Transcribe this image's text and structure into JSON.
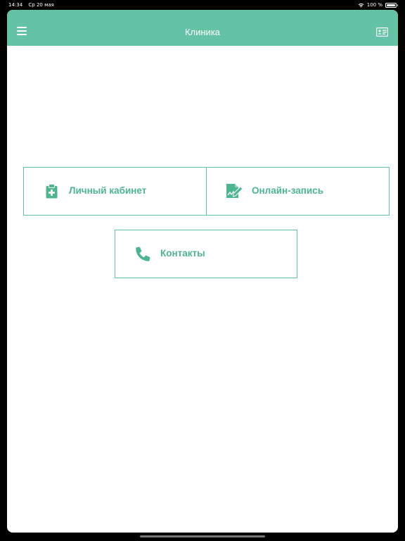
{
  "status_bar": {
    "time": "14:34",
    "date": "Ср 20 мая",
    "battery": "100 %",
    "wifi_icon": "wifi-icon",
    "battery_icon": "battery-icon"
  },
  "navbar": {
    "title": "Клиника",
    "menu_icon": "hamburger-menu-icon",
    "right_icon": "id-card-icon",
    "color": "#64c3a4"
  },
  "tiles": [
    {
      "label": "Личный кабинет",
      "icon": "medical-clipboard-icon"
    },
    {
      "label": "Онлайн-запись",
      "icon": "signature-document-icon"
    },
    {
      "label": "Контакты",
      "icon": "phone-icon"
    }
  ],
  "colors": {
    "accent": "#64c3a4",
    "label": "#4db58f"
  }
}
